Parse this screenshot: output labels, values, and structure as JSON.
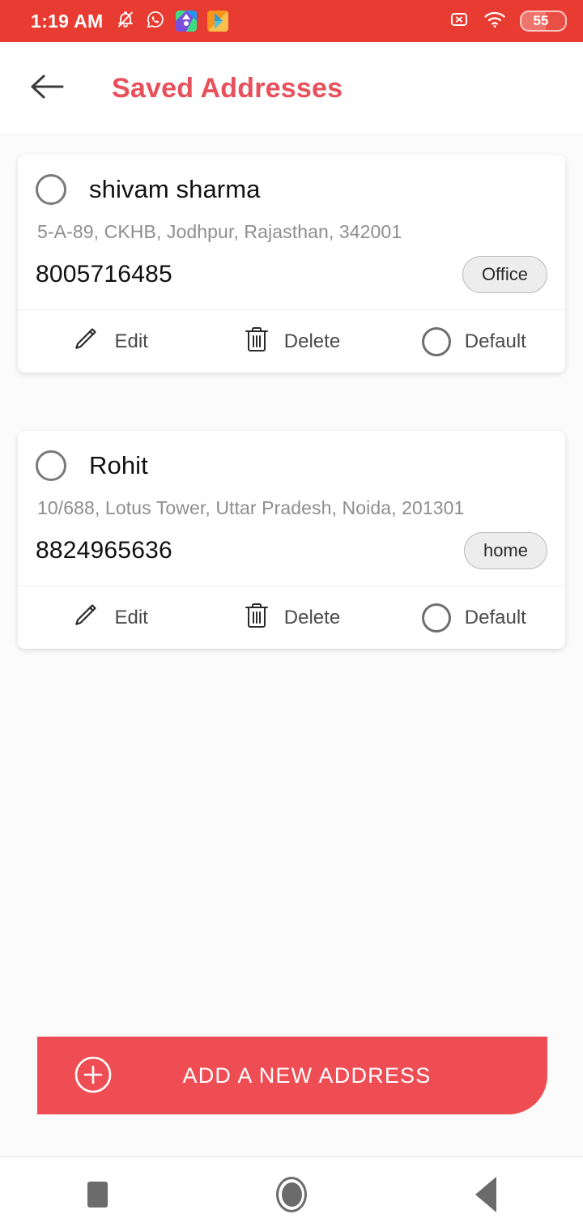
{
  "status_bar": {
    "time": "1:19 AM",
    "icons": [
      "bell-muted-icon",
      "whatsapp-icon",
      "app-icon-teal",
      "app-icon-orange"
    ],
    "sim_icon": "sim-card-x-icon",
    "wifi_icon": "wifi-icon",
    "battery_level": "55",
    "background_color": "#e83b32"
  },
  "header": {
    "back_icon": "back-arrow-icon",
    "title": "Saved Addresses",
    "title_color": "#e8505b"
  },
  "addresses": [
    {
      "name": "shivam sharma",
      "address": "5-A-89, CKHB,  Jodhpur, Rajasthan, 342001",
      "phone": "8005716485",
      "badge": "Office",
      "selected": false,
      "is_default": false,
      "actions": {
        "edit_label": "Edit",
        "delete_label": "Delete",
        "default_label": "Default"
      }
    },
    {
      "name": "Rohit",
      "address": "10/688, Lotus Tower, Uttar Pradesh, Noida, 201301",
      "phone": "8824965636",
      "badge": "home",
      "selected": false,
      "is_default": false,
      "actions": {
        "edit_label": "Edit",
        "delete_label": "Delete",
        "default_label": "Default"
      }
    }
  ],
  "cta": {
    "label": "ADD A NEW ADDRESS",
    "icon": "plus-circle-icon",
    "color": "#ef4d54"
  },
  "nav_bar": {
    "recents_icon": "square-recents-icon",
    "home_icon": "circle-home-icon",
    "back_icon": "triangle-back-icon"
  }
}
